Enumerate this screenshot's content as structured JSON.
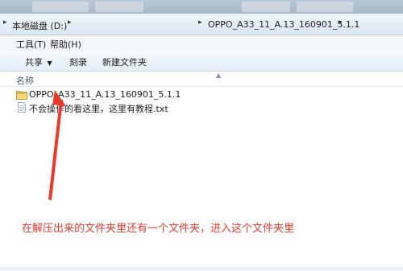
{
  "address_bar": {
    "root_segment": "本地磁盘 (D:)",
    "folder_segment": "OPPO_A33_11_A.13_160901_5.1.1"
  },
  "menu": {
    "tools": "工具(T)",
    "help": "帮助(H)"
  },
  "toolbar": {
    "share": "共享",
    "burn": "刻录",
    "new_folder": "新建文件夹"
  },
  "list": {
    "column_name": "名称",
    "items": [
      {
        "label": "OPPO_A33_11_A.13_160901_5.1.1",
        "type": "folder"
      },
      {
        "label": "不会操作的看这里，这里有教程.txt",
        "type": "text-file"
      }
    ]
  },
  "annotation": {
    "text": "在解压出来的文件夹里还有一个文件夹，进入这个文件夹里",
    "color": "#e8392c"
  },
  "icons": {
    "folder": "folder-icon",
    "text_file": "text-file-icon",
    "dropdown": "chevron-down-icon",
    "breadcrumb_arrow": "chevron-right-icon"
  }
}
